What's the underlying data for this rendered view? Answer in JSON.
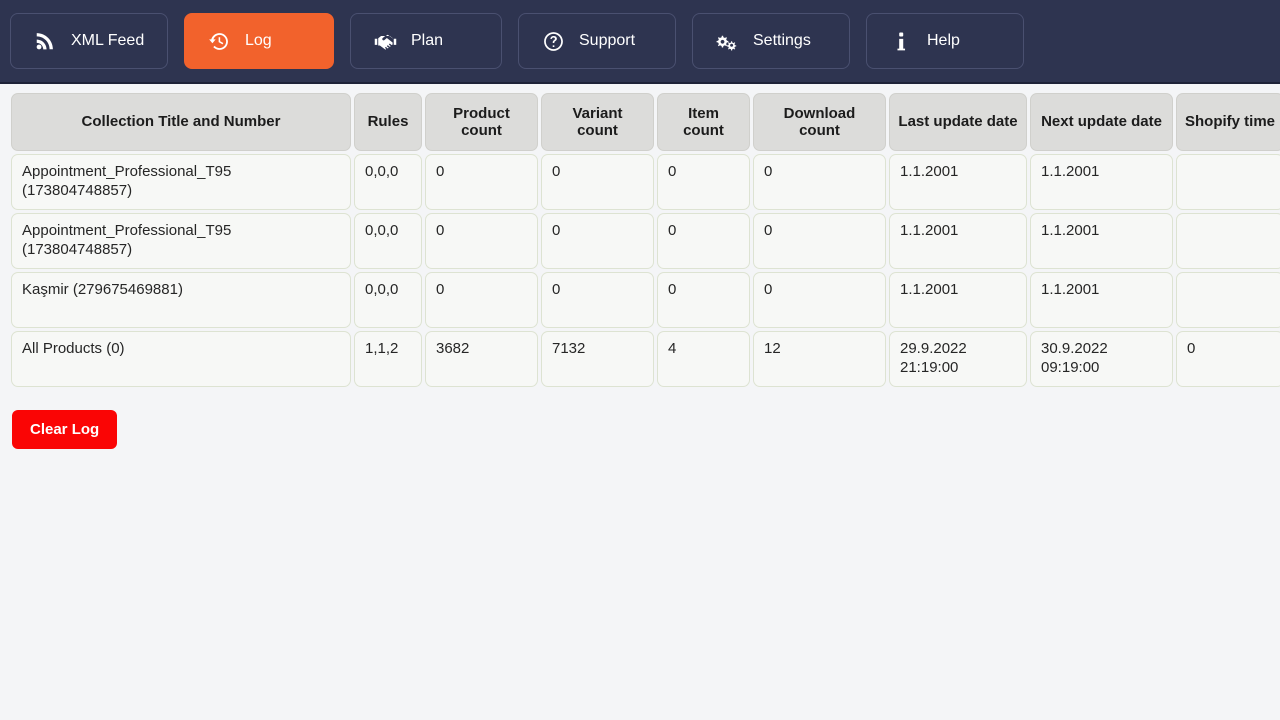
{
  "nav": {
    "items": [
      {
        "id": "xml-feed",
        "label": "XML Feed",
        "icon": "rss-icon",
        "active": false
      },
      {
        "id": "log",
        "label": "Log",
        "icon": "history-icon",
        "active": true
      },
      {
        "id": "plan",
        "label": "Plan",
        "icon": "handshake-icon",
        "active": false
      },
      {
        "id": "support",
        "label": "Support",
        "icon": "question-circle-icon",
        "active": false
      },
      {
        "id": "settings",
        "label": "Settings",
        "icon": "cogs-icon",
        "active": false
      },
      {
        "id": "help",
        "label": "Help",
        "icon": "info-icon",
        "active": false
      }
    ],
    "active_color": "#f2622c",
    "bar_color": "#2e3450"
  },
  "table": {
    "headers": [
      "Collection Title and Number",
      "Rules",
      "Product count",
      "Variant count",
      "Item count",
      "Download count",
      "Last update date",
      "Next update date",
      "Shopify time",
      ""
    ],
    "rows": [
      {
        "title": "Appointment_Professional_T95",
        "title_line2": "(173804748857)",
        "rules": "0,0,0",
        "product_count": "0",
        "variant_count": "0",
        "item_count": "0",
        "download_count": "0",
        "last_update_date": "1.1.2001",
        "last_update_time": "",
        "next_update_date": "1.1.2001",
        "next_update_time": "",
        "shopify_time": "",
        "extra": ""
      },
      {
        "title": "Appointment_Professional_T95",
        "title_line2": "(173804748857)",
        "rules": "0,0,0",
        "product_count": "0",
        "variant_count": "0",
        "item_count": "0",
        "download_count": "0",
        "last_update_date": "1.1.2001",
        "last_update_time": "",
        "next_update_date": "1.1.2001",
        "next_update_time": "",
        "shopify_time": "",
        "extra": ""
      },
      {
        "title": "Kaşmir (279675469881)",
        "title_line2": "",
        "rules": "0,0,0",
        "product_count": "0",
        "variant_count": "0",
        "item_count": "0",
        "download_count": "0",
        "last_update_date": "1.1.2001",
        "last_update_time": "",
        "next_update_date": "1.1.2001",
        "next_update_time": "",
        "shopify_time": "",
        "extra": ""
      },
      {
        "title": "All Products (0)",
        "title_line2": "",
        "rules": "1,1,2",
        "product_count": "3682",
        "variant_count": "7132",
        "item_count": "4",
        "download_count": "12",
        "last_update_date": "29.9.2022",
        "last_update_time": "21:19:00",
        "next_update_date": "30.9.2022",
        "next_update_time": "09:19:00",
        "shopify_time": "0",
        "extra": ""
      }
    ]
  },
  "actions": {
    "clear_log_label": "Clear Log",
    "clear_log_color": "#fa0505"
  }
}
